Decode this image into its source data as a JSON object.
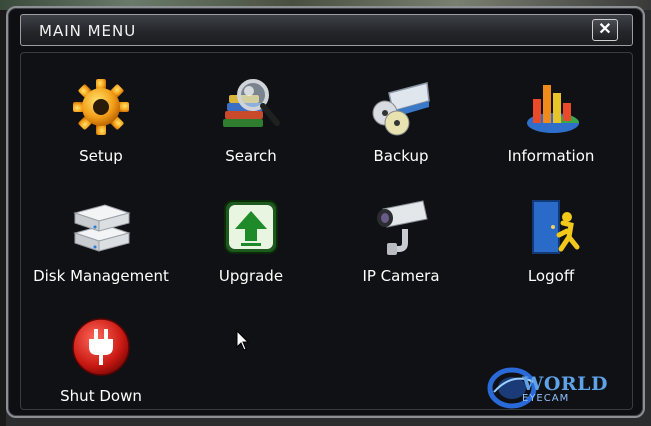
{
  "window": {
    "title": "MAIN MENU",
    "close_label": "✕"
  },
  "menu": {
    "items": [
      {
        "label": "Setup",
        "icon": "gear-icon"
      },
      {
        "label": "Search",
        "icon": "magnifier-books-icon"
      },
      {
        "label": "Backup",
        "icon": "backup-discs-icon"
      },
      {
        "label": "Information",
        "icon": "chart-icon"
      },
      {
        "label": "Disk Management",
        "icon": "hard-disk-icon"
      },
      {
        "label": "Upgrade",
        "icon": "upgrade-arrow-icon"
      },
      {
        "label": "IP Camera",
        "icon": "security-camera-icon"
      },
      {
        "label": "Logoff",
        "icon": "logoff-door-icon"
      },
      {
        "label": "Shut Down",
        "icon": "power-plug-icon"
      }
    ]
  },
  "branding": {
    "logo_line1": "WORLD",
    "logo_line2": "EYECAM"
  },
  "colors": {
    "window_bg": "#0e0f12",
    "title_text": "#f2f2f2",
    "label_text": "#ffffff",
    "logo_blue": "#5fa2e8"
  }
}
